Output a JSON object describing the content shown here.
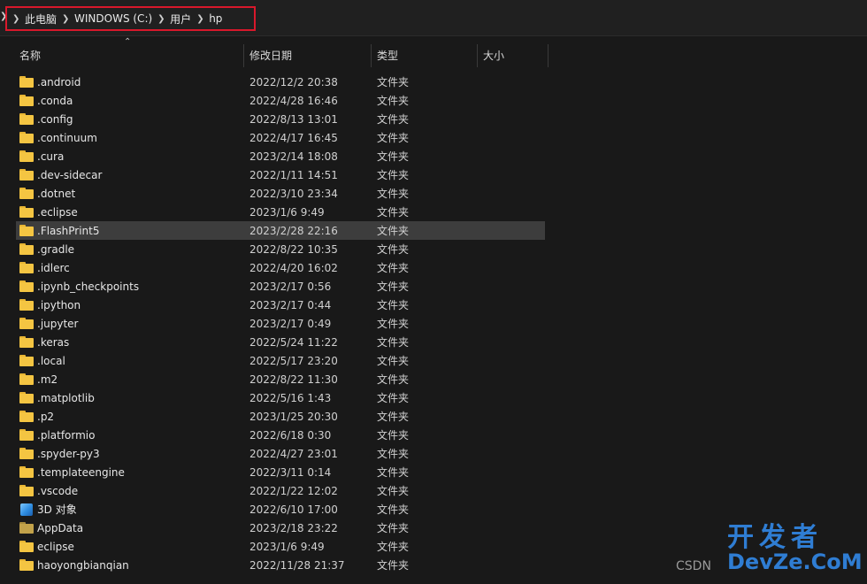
{
  "breadcrumb": {
    "items": [
      "此电脑",
      "WINDOWS (C:)",
      "用户",
      "hp"
    ]
  },
  "columns": {
    "name": "名称",
    "date": "修改日期",
    "type": "类型",
    "size": "大小"
  },
  "rows": [
    {
      "name": ".android",
      "date": "2022/12/2 20:38",
      "type": "文件夹",
      "icon": "folder-icon"
    },
    {
      "name": ".conda",
      "date": "2022/4/28 16:46",
      "type": "文件夹",
      "icon": "folder-icon"
    },
    {
      "name": ".config",
      "date": "2022/8/13 13:01",
      "type": "文件夹",
      "icon": "folder-icon"
    },
    {
      "name": ".continuum",
      "date": "2022/4/17 16:45",
      "type": "文件夹",
      "icon": "folder-icon"
    },
    {
      "name": ".cura",
      "date": "2023/2/14 18:08",
      "type": "文件夹",
      "icon": "folder-icon"
    },
    {
      "name": ".dev-sidecar",
      "date": "2022/1/11 14:51",
      "type": "文件夹",
      "icon": "folder-icon"
    },
    {
      "name": ".dotnet",
      "date": "2022/3/10 23:34",
      "type": "文件夹",
      "icon": "folder-icon"
    },
    {
      "name": ".eclipse",
      "date": "2023/1/6 9:49",
      "type": "文件夹",
      "icon": "folder-icon"
    },
    {
      "name": ".FlashPrint5",
      "date": "2023/2/28 22:16",
      "type": "文件夹",
      "icon": "folder-icon",
      "selected": true
    },
    {
      "name": ".gradle",
      "date": "2022/8/22 10:35",
      "type": "文件夹",
      "icon": "folder-icon"
    },
    {
      "name": ".idlerc",
      "date": "2022/4/20 16:02",
      "type": "文件夹",
      "icon": "folder-icon"
    },
    {
      "name": ".ipynb_checkpoints",
      "date": "2023/2/17 0:56",
      "type": "文件夹",
      "icon": "folder-icon"
    },
    {
      "name": ".ipython",
      "date": "2023/2/17 0:44",
      "type": "文件夹",
      "icon": "folder-icon"
    },
    {
      "name": ".jupyter",
      "date": "2023/2/17 0:49",
      "type": "文件夹",
      "icon": "folder-icon"
    },
    {
      "name": ".keras",
      "date": "2022/5/24 11:22",
      "type": "文件夹",
      "icon": "folder-icon"
    },
    {
      "name": ".local",
      "date": "2022/5/17 23:20",
      "type": "文件夹",
      "icon": "folder-icon"
    },
    {
      "name": ".m2",
      "date": "2022/8/22 11:30",
      "type": "文件夹",
      "icon": "folder-icon"
    },
    {
      "name": ".matplotlib",
      "date": "2022/5/16 1:43",
      "type": "文件夹",
      "icon": "folder-icon"
    },
    {
      "name": ".p2",
      "date": "2023/1/25 20:30",
      "type": "文件夹",
      "icon": "folder-icon"
    },
    {
      "name": ".platformio",
      "date": "2022/6/18 0:30",
      "type": "文件夹",
      "icon": "folder-icon"
    },
    {
      "name": ".spyder-py3",
      "date": "2022/4/27 23:01",
      "type": "文件夹",
      "icon": "folder-icon"
    },
    {
      "name": ".templateengine",
      "date": "2022/3/11 0:14",
      "type": "文件夹",
      "icon": "folder-icon"
    },
    {
      "name": ".vscode",
      "date": "2022/1/22 12:02",
      "type": "文件夹",
      "icon": "folder-icon"
    },
    {
      "name": "3D 对象",
      "date": "2022/6/10 17:00",
      "type": "文件夹",
      "icon": "3d-objects-icon"
    },
    {
      "name": "AppData",
      "date": "2023/2/18 23:22",
      "type": "文件夹",
      "icon": "folder-dim-icon"
    },
    {
      "name": "eclipse",
      "date": "2023/1/6 9:49",
      "type": "文件夹",
      "icon": "folder-icon"
    },
    {
      "name": "haoyongbianqian",
      "date": "2022/11/28 21:37",
      "type": "文件夹",
      "icon": "folder-icon"
    }
  ],
  "watermark": {
    "site": "CSDN",
    "brand_cn": "开发者",
    "brand_en": "DevZe.CoM"
  },
  "colors": {
    "background": "#191919",
    "selected_row": "#3d3d3d",
    "highlight_box": "#d9182b",
    "folder": "#f4c542"
  }
}
